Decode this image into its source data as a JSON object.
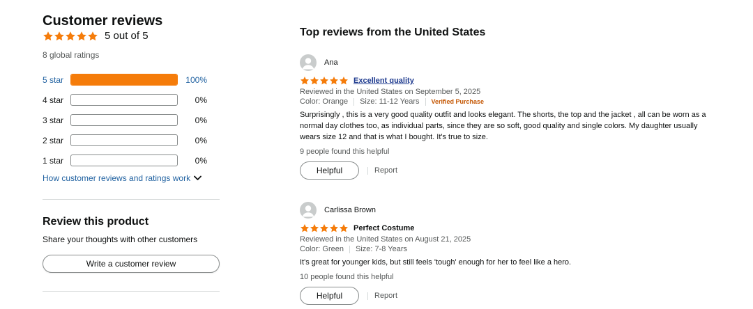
{
  "customer_reviews": {
    "title": "Customer reviews",
    "rating_text": "5 out of 5",
    "rating_value": 5,
    "global_ratings": "8 global ratings",
    "histogram": [
      {
        "label": "5 star",
        "percent": 100,
        "percent_text": "100%"
      },
      {
        "label": "4 star",
        "percent": 0,
        "percent_text": "0%"
      },
      {
        "label": "3 star",
        "percent": 0,
        "percent_text": "0%"
      },
      {
        "label": "2 star",
        "percent": 0,
        "percent_text": "0%"
      },
      {
        "label": "1 star",
        "percent": 0,
        "percent_text": "0%"
      }
    ],
    "how_link": "How customer reviews and ratings work"
  },
  "review_product": {
    "title": "Review this product",
    "subtitle": "Share your thoughts with other customers",
    "button": "Write a customer review"
  },
  "top_reviews": {
    "title": "Top reviews from the United States",
    "reviews": [
      {
        "author": "Ana",
        "rating": 5,
        "title": "Excellent quality",
        "meta": "Reviewed in the United States on September 5, 2025",
        "color": "Color: Orange",
        "size": "Size: 11-12 Years",
        "verified": "Verified Purchase",
        "body": "Surprisingly , this is a very good quality outfit and looks elegant. The shorts, the top and the jacket , all can be worn as a normal day clothes too, as individual parts, since they are so soft, good quality and single colors. My daughter usually wears size 12 and that is what I bought. It's true to size.",
        "helpful_count": "9 people found this helpful",
        "helpful_button": "Helpful",
        "report": "Report"
      },
      {
        "author": "Carlissa Brown",
        "rating": 5,
        "title": "Perfect Costume",
        "meta": "Reviewed in the United States on August 21, 2025",
        "color": "Color: Green",
        "size": "Size: 7-8 Years",
        "body": "It's great for younger kids, but still feels 'tough' enough for her to feel like a hero.",
        "helpful_count": "10 people found this helpful",
        "helpful_button": "Helpful",
        "report": "Report"
      }
    ]
  },
  "colors": {
    "star": "#f57c0a",
    "link": "#2162a1",
    "verified": "#c45500"
  },
  "icons": {
    "star": "star-icon",
    "chevron": "chevron-down-icon",
    "avatar": "avatar-icon"
  }
}
